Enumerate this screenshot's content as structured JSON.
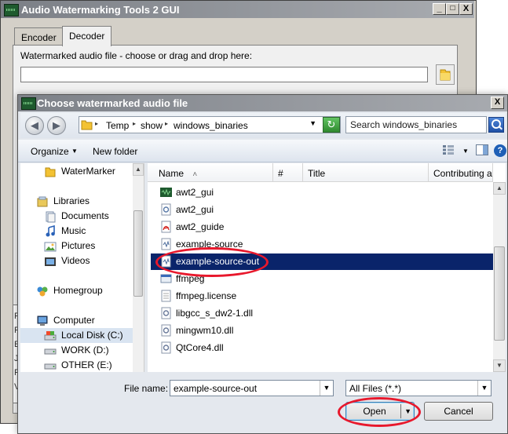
{
  "main_window": {
    "title": "Audio Watermarking Tools 2 GUI",
    "minimize_glyph": "_",
    "maximize_glyph": "□",
    "close_glyph": "X",
    "tabs": [
      {
        "label": "Encoder",
        "active": false
      },
      {
        "label": "Decoder",
        "active": true
      }
    ],
    "decoder": {
      "file_label": "Watermarked audio file - choose or drag and drop here:",
      "file_value": ""
    },
    "log_partial_chars": [
      "F",
      "F",
      "E",
      "J",
      "F",
      "V"
    ]
  },
  "dialog": {
    "title": "Choose watermarked audio file",
    "close_glyph": "X",
    "nav_back_glyph": "◀",
    "nav_forward_glyph": "▶",
    "breadcrumb": [
      "Temp",
      "show",
      "windows_binaries"
    ],
    "crumb_separator": "▸",
    "dropdown_glyph": "▼",
    "refresh_glyph": "↻",
    "search_placeholder": "Search windows_binaries",
    "toolbar": {
      "organize_label": "Organize",
      "organize_arrow": "▼",
      "new_folder_label": "New folder",
      "views_arrow": "▼",
      "help_glyph": "?"
    },
    "nav_pane": {
      "items": [
        {
          "label": "WaterMarker",
          "icon": "folder-icon"
        },
        {
          "label": "Libraries",
          "icon": "libraries-icon"
        },
        {
          "label": "Documents",
          "icon": "documents-icon"
        },
        {
          "label": "Music",
          "icon": "music-icon"
        },
        {
          "label": "Pictures",
          "icon": "pictures-icon"
        },
        {
          "label": "Videos",
          "icon": "videos-icon"
        },
        {
          "label": "Homegroup",
          "icon": "homegroup-icon"
        },
        {
          "label": "Computer",
          "icon": "computer-icon"
        },
        {
          "label": "Local Disk (C:)",
          "icon": "drive-icon",
          "selected": true
        },
        {
          "label": "WORK (D:)",
          "icon": "drive-icon"
        },
        {
          "label": "OTHER (E:)",
          "icon": "drive-icon"
        }
      ]
    },
    "columns": [
      "Name",
      "#",
      "Title",
      "Contributing art"
    ],
    "sort_glyph": "˄",
    "scroll_up_glyph": "▲",
    "scroll_down_glyph": "▼",
    "files": [
      {
        "name": "awt2_gui",
        "icon": "app-icon"
      },
      {
        "name": "awt2_gui",
        "icon": "config-file-icon"
      },
      {
        "name": "awt2_guide",
        "icon": "pdf-icon"
      },
      {
        "name": "example-source",
        "icon": "audio-file-icon"
      },
      {
        "name": "example-source-out",
        "icon": "audio-file-icon",
        "selected": true
      },
      {
        "name": "ffmpeg",
        "icon": "exe-icon"
      },
      {
        "name": "ffmpeg.license",
        "icon": "text-file-icon"
      },
      {
        "name": "libgcc_s_dw2-1.dll",
        "icon": "dll-icon"
      },
      {
        "name": "mingwm10.dll",
        "icon": "dll-icon"
      },
      {
        "name": "QtCore4.dll",
        "icon": "dll-icon"
      }
    ],
    "file_name_label": "File name:",
    "file_name_value": "example-source-out",
    "file_type_value": "All Files (*.*)",
    "open_label": "Open",
    "cancel_label": "Cancel"
  },
  "colors": {
    "selection": "#0a246a",
    "annotation_red": "#e8182c",
    "title_bar": "#7b7f86"
  }
}
